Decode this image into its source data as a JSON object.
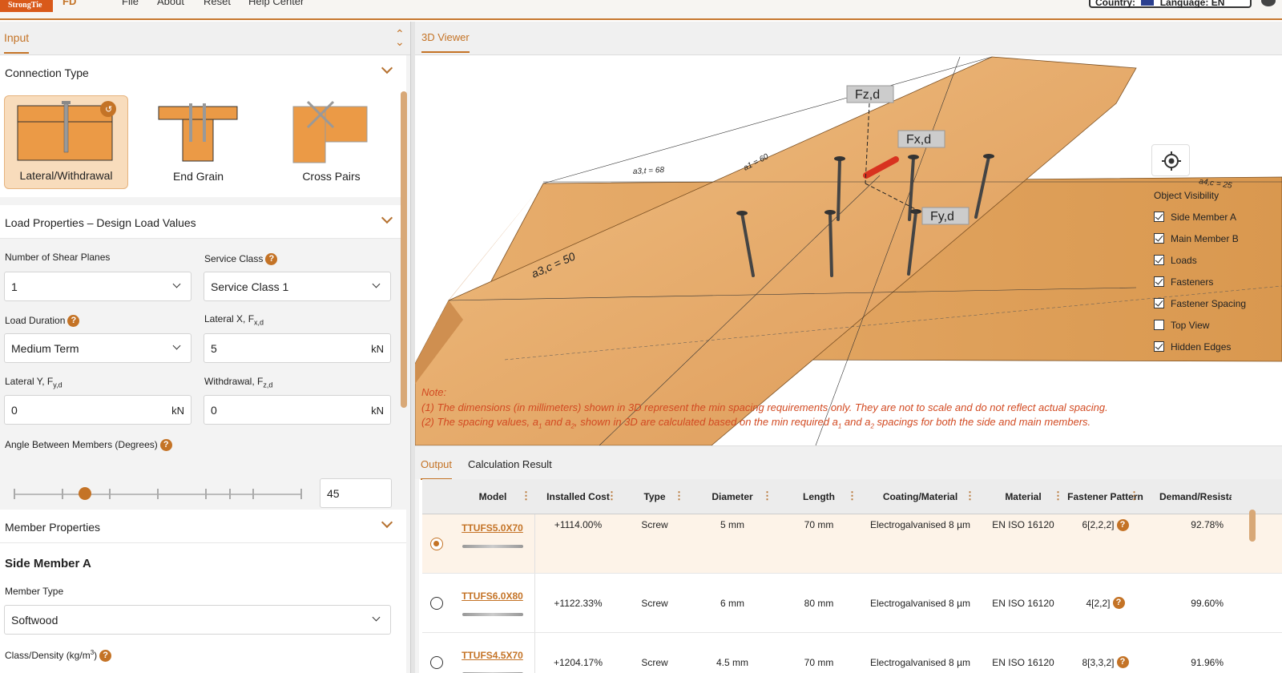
{
  "header": {
    "logo_text": "StrongTie",
    "app_abbrev": "FD",
    "nav": [
      "File",
      "About",
      "Reset",
      "Help Center"
    ],
    "country_label": "Country:",
    "language_label": "Language: EN"
  },
  "input_panel": {
    "tab_label": "Input",
    "connection_type": {
      "title": "Connection Type",
      "options": [
        {
          "label": "Lateral/Withdrawal",
          "selected": true
        },
        {
          "label": "End Grain",
          "selected": false
        },
        {
          "label": "Cross Pairs",
          "selected": false
        }
      ]
    },
    "load_properties": {
      "title": "Load Properties – Design Load Values",
      "shear_planes_label": "Number of Shear Planes",
      "shear_planes_value": "1",
      "service_class_label": "Service Class",
      "service_class_value": "Service Class 1",
      "load_duration_label": "Load Duration",
      "load_duration_value": "Medium Term",
      "lateral_x_label": "Lateral X, F",
      "lateral_x_sub": "x,d",
      "lateral_x_value": "5",
      "lateral_y_label": "Lateral Y, F",
      "lateral_y_sub": "y,d",
      "lateral_y_value": "0",
      "withdrawal_label": "Withdrawal, F",
      "withdrawal_sub": "z,d",
      "withdrawal_value": "0",
      "unit": "kN",
      "angle_label": "Angle Between Members (Degrees)",
      "angle_value": "45",
      "angle_ticks": [
        "0",
        "30",
        "45",
        "60",
        "90",
        "120",
        "135",
        "150",
        "180"
      ]
    },
    "member_properties": {
      "title": "Member Properties",
      "side_member_title": "Side Member A",
      "member_type_label": "Member Type",
      "member_type_value": "Softwood",
      "class_density_label": "Class/Density (kg/m",
      "class_density_sup": "3",
      "class_density_close": ")"
    }
  },
  "viewer": {
    "tab_label": "3D Viewer",
    "force_labels": [
      "Fz,d",
      "Fx,d",
      "Fy,d"
    ],
    "dim_labels": [
      "a3,t = 68",
      "a1 = 60",
      "a3,c = 50",
      "a4,c = 25"
    ],
    "visibility_title": "Object Visibility",
    "visibility": [
      {
        "label": "Side Member A",
        "checked": true
      },
      {
        "label": "Main Member B",
        "checked": true
      },
      {
        "label": "Loads",
        "checked": true
      },
      {
        "label": "Fasteners",
        "checked": true
      },
      {
        "label": "Fastener Spacing",
        "checked": true
      },
      {
        "label": "Top View",
        "checked": false
      },
      {
        "label": "Hidden Edges",
        "checked": true
      }
    ],
    "note_title": "Note:",
    "note_1": "(1) The dimensions (in millimeters) shown in 3D represent the min spacing requirements only. They are not to scale and do not reflect actual spacing.",
    "note_2_a": "(2) The spacing values, a",
    "note_2_b": " and a",
    "note_2_c": ", shown in 3D are calculated based on the min required a",
    "note_2_d": " and a",
    "note_2_e": " spacings for both the side and main members.",
    "sub1": "1",
    "sub2": "2"
  },
  "output": {
    "tabs": [
      "Output",
      "Calculation Result"
    ],
    "columns": [
      "Model",
      "Installed Cost",
      "Type",
      "Diameter",
      "Length",
      "Coating/Material",
      "Material",
      "Fastener Pattern",
      "Demand/Resistance % Lateral"
    ],
    "rows": [
      {
        "selected": true,
        "model": "TTUFS5.0X70",
        "cost": "+1114.00%",
        "type": "Screw",
        "diameter": "5 mm",
        "length": "70 mm",
        "coating": "Electrogalvanised 8 µm",
        "material": "EN ISO 16120",
        "pattern": "6[2,2,2]",
        "ratio": "92.78%"
      },
      {
        "selected": false,
        "model": "TTUFS6.0X80",
        "cost": "+1122.33%",
        "type": "Screw",
        "diameter": "6 mm",
        "length": "80 mm",
        "coating": "Electrogalvanised 8 µm",
        "material": "EN ISO 16120",
        "pattern": "4[2,2]",
        "ratio": "99.60%"
      },
      {
        "selected": false,
        "model": "TTUFS4.5X70",
        "cost": "+1204.17%",
        "type": "Screw",
        "diameter": "4.5 mm",
        "length": "70 mm",
        "coating": "Electrogalvanised 8 µm",
        "material": "EN ISO 16120",
        "pattern": "8[3,3,2]",
        "ratio": "91.96%"
      }
    ]
  },
  "colors": {
    "accent": "#c47326",
    "wood": "#e7a566",
    "note": "#d24a22"
  }
}
